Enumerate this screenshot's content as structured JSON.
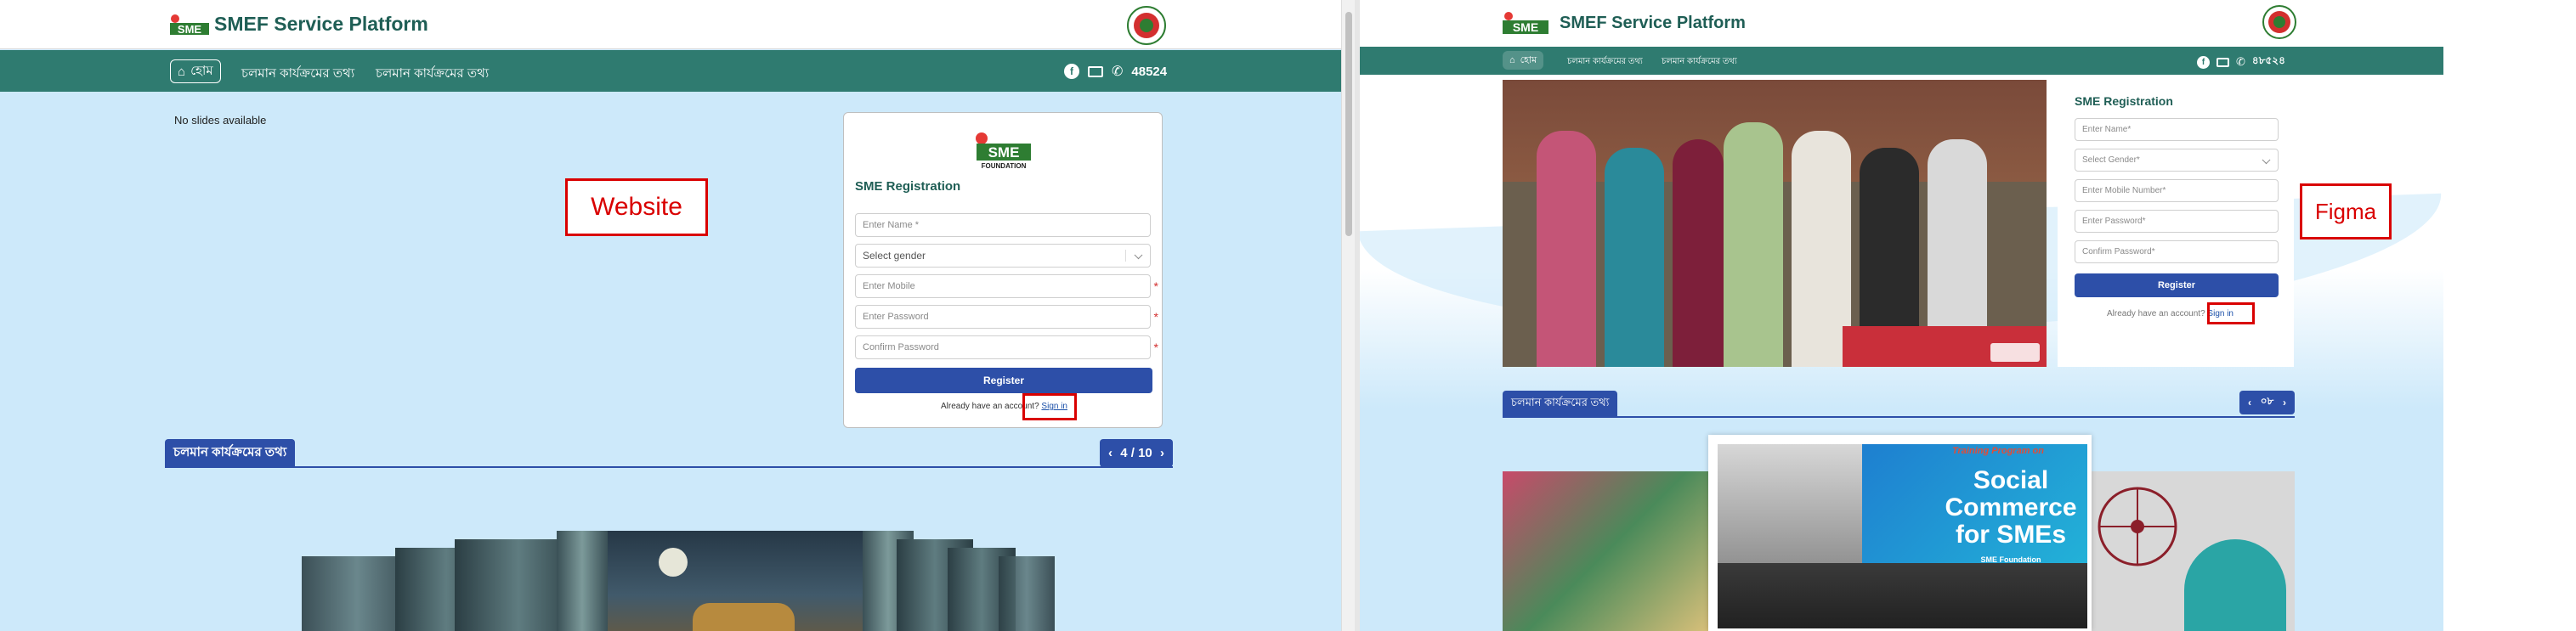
{
  "brand": {
    "title": "SMEF Service Platform",
    "logo_text": "SME",
    "logo_sub": "FOUNDATION"
  },
  "nav": {
    "home": "হোম",
    "link1": "চলমান কার্যক্রমের তথ্য",
    "link2": "চলমান কার্যক্রমের তথ্য",
    "phone_left": "48524",
    "phone_right": "৪৮৫২৪"
  },
  "website": {
    "annotation": "Website",
    "no_slides": "No slides available",
    "registration": {
      "title": "SME Registration",
      "name_placeholder": "Enter Name *",
      "gender_placeholder": "Select gender",
      "mobile_placeholder": "Enter Mobile",
      "password_placeholder": "Enter Password",
      "confirm_placeholder": "Confirm Password",
      "required_mark": "*",
      "register_label": "Register",
      "already_text": "Already have an account?",
      "signin_label": "Sign in"
    },
    "section": {
      "title": "চলমান কার্যক্রমের তথ্য",
      "pager": "4 / 10",
      "prev": "‹",
      "next": "›"
    }
  },
  "figma": {
    "annotation": "Figma",
    "registration": {
      "title": "SME Registration",
      "name_placeholder": "Enter Name*",
      "gender_placeholder": "Select Gender*",
      "mobile_placeholder": "Enter Mobile Number*",
      "password_placeholder": "Enter Password*",
      "confirm_placeholder": "Confirm Password*",
      "register_label": "Register",
      "already_text": "Already have an account?",
      "signin_label": "Sign in"
    },
    "section": {
      "title": "চলমান কার্যক্রমের তথ্য",
      "pager": "০৮",
      "prev": "‹",
      "next": "›"
    },
    "card_text": {
      "line1": "Social",
      "line2": "Commerce",
      "line3": "for SMEs",
      "banner": "Training Program on",
      "footer": "SME Foundation"
    }
  },
  "colors": {
    "teal": "#2f7b70",
    "blue": "#2d4fa8",
    "light_bg": "#cde9fa",
    "annotation_red": "#d90000"
  },
  "icons": [
    "home-icon",
    "facebook-icon",
    "mail-icon",
    "phone-icon",
    "chevron-down-icon",
    "chevron-left-icon",
    "chevron-right-icon"
  ]
}
